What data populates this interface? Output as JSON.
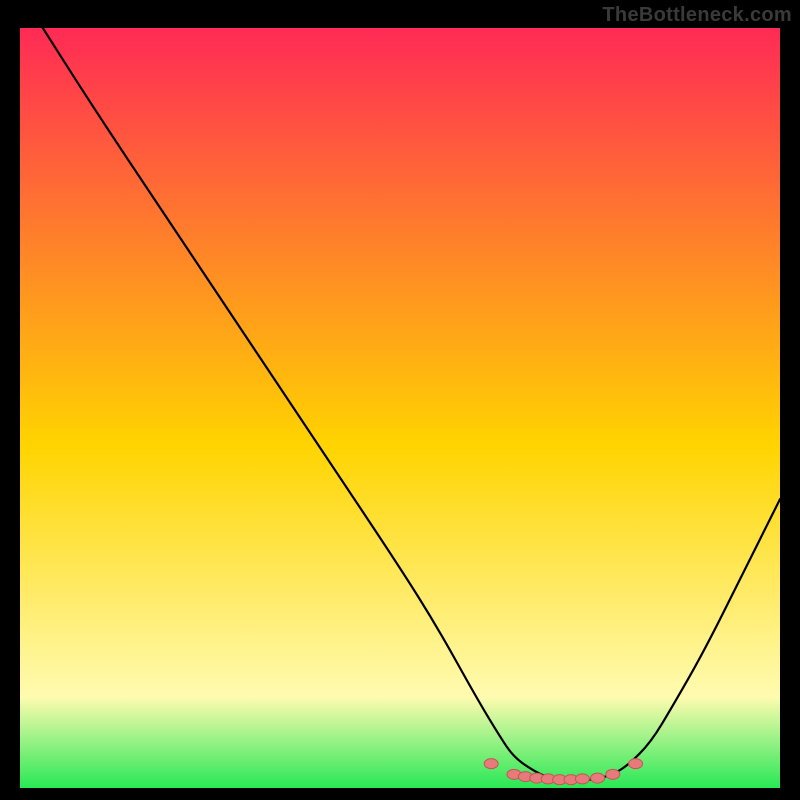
{
  "watermark": "TheBottleneck.com",
  "colors": {
    "gradient_top": "#ff2a55",
    "gradient_mid": "#ffd400",
    "gradient_lowlight": "#fffbb0",
    "gradient_bottom": "#28e856",
    "curve": "#000000",
    "dot_fill": "#e77a7a",
    "dot_stroke": "#c35656",
    "background": "#000000"
  },
  "chart_data": {
    "type": "line",
    "title": "",
    "xlabel": "",
    "ylabel": "",
    "xlim": [
      0,
      100
    ],
    "ylim": [
      0,
      100
    ],
    "series": [
      {
        "name": "bottleneck-curve",
        "x": [
          3,
          10,
          20,
          30,
          40,
          50,
          55,
          60,
          63,
          65,
          68,
          70,
          72,
          74,
          76,
          78,
          80,
          83,
          86,
          90,
          95,
          100
        ],
        "y": [
          100,
          89,
          74,
          59,
          44,
          29,
          21,
          12,
          7,
          4,
          2,
          1.2,
          1,
          1,
          1.2,
          1.8,
          3,
          6,
          11,
          18,
          28,
          38
        ]
      }
    ],
    "markers": {
      "name": "optimal-range-dots",
      "x": [
        62,
        65,
        66.5,
        68,
        69.5,
        71,
        72.5,
        74,
        76,
        78,
        81
      ],
      "y": [
        3.2,
        1.8,
        1.5,
        1.3,
        1.2,
        1.1,
        1.1,
        1.2,
        1.3,
        1.8,
        3.2
      ]
    }
  }
}
